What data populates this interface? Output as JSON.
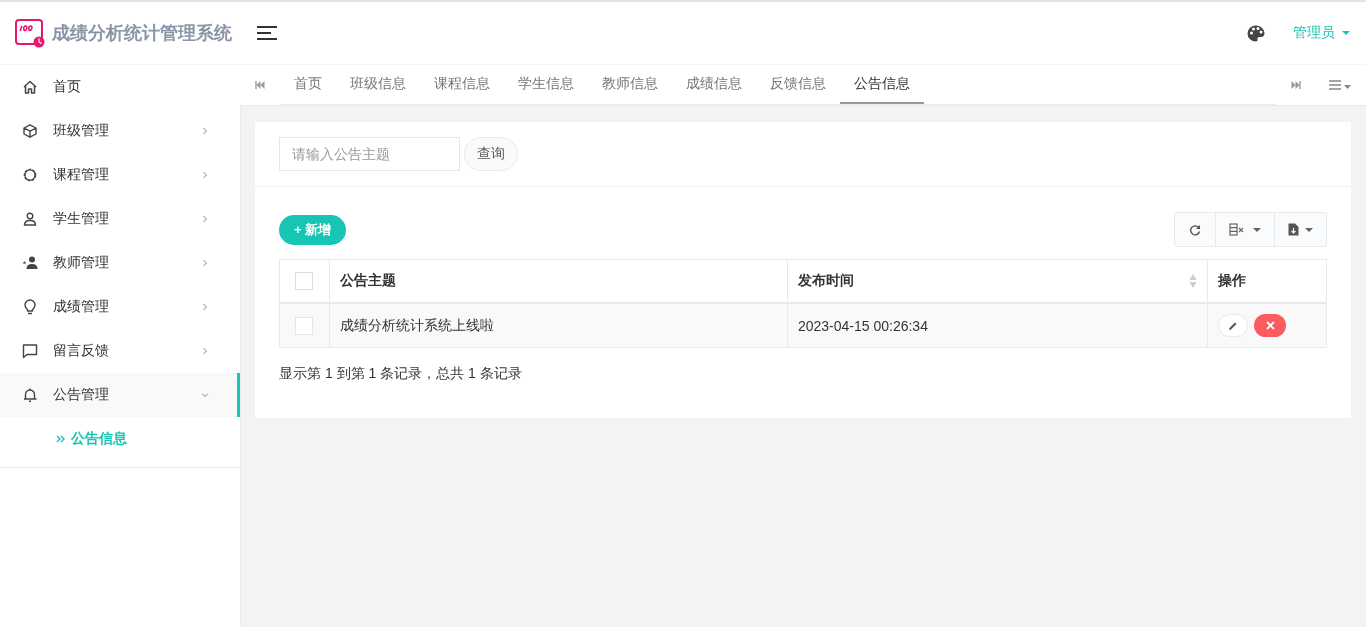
{
  "app": {
    "title": "成绩分析统计管理系统"
  },
  "sidebar": {
    "items": [
      {
        "label": "首页",
        "kind": "link",
        "selected": false
      },
      {
        "label": "班级管理",
        "kind": "group",
        "expanded": false,
        "selected": false
      },
      {
        "label": "课程管理",
        "kind": "group",
        "expanded": false,
        "selected": false
      },
      {
        "label": "学生管理",
        "kind": "group",
        "expanded": false,
        "selected": false
      },
      {
        "label": "教师管理",
        "kind": "group",
        "expanded": false,
        "selected": false
      },
      {
        "label": "成绩管理",
        "kind": "group",
        "expanded": false,
        "selected": false
      },
      {
        "label": "留言反馈",
        "kind": "group",
        "expanded": false,
        "selected": false
      },
      {
        "label": "公告管理",
        "kind": "group",
        "expanded": true,
        "selected": true,
        "children": [
          {
            "label": "公告信息",
            "selected": true
          }
        ]
      }
    ]
  },
  "header": {
    "user": "管理员"
  },
  "tabs": [
    {
      "label": "首页",
      "selected": false
    },
    {
      "label": "班级信息",
      "selected": false
    },
    {
      "label": "课程信息",
      "selected": false
    },
    {
      "label": "学生信息",
      "selected": false
    },
    {
      "label": "教师信息",
      "selected": false
    },
    {
      "label": "成绩信息",
      "selected": false
    },
    {
      "label": "反馈信息",
      "selected": false
    },
    {
      "label": "公告信息",
      "selected": true
    }
  ],
  "search": {
    "placeholder": "请输入公告主题",
    "button": "查询"
  },
  "add_button": "+ 新增",
  "table": {
    "header_checked": false,
    "columns": [
      {
        "label": "公告主题",
        "sortable": false
      },
      {
        "label": "发布时间",
        "sortable": true
      },
      {
        "label": "操作",
        "sortable": false
      }
    ],
    "rows": [
      {
        "checked": false,
        "cells": [
          "成绩分析统计系统上线啦",
          "2023-04-15 00:26:34"
        ]
      }
    ]
  },
  "pagination": "显示第 1 到第 1 条记录，总共 1 条记录"
}
